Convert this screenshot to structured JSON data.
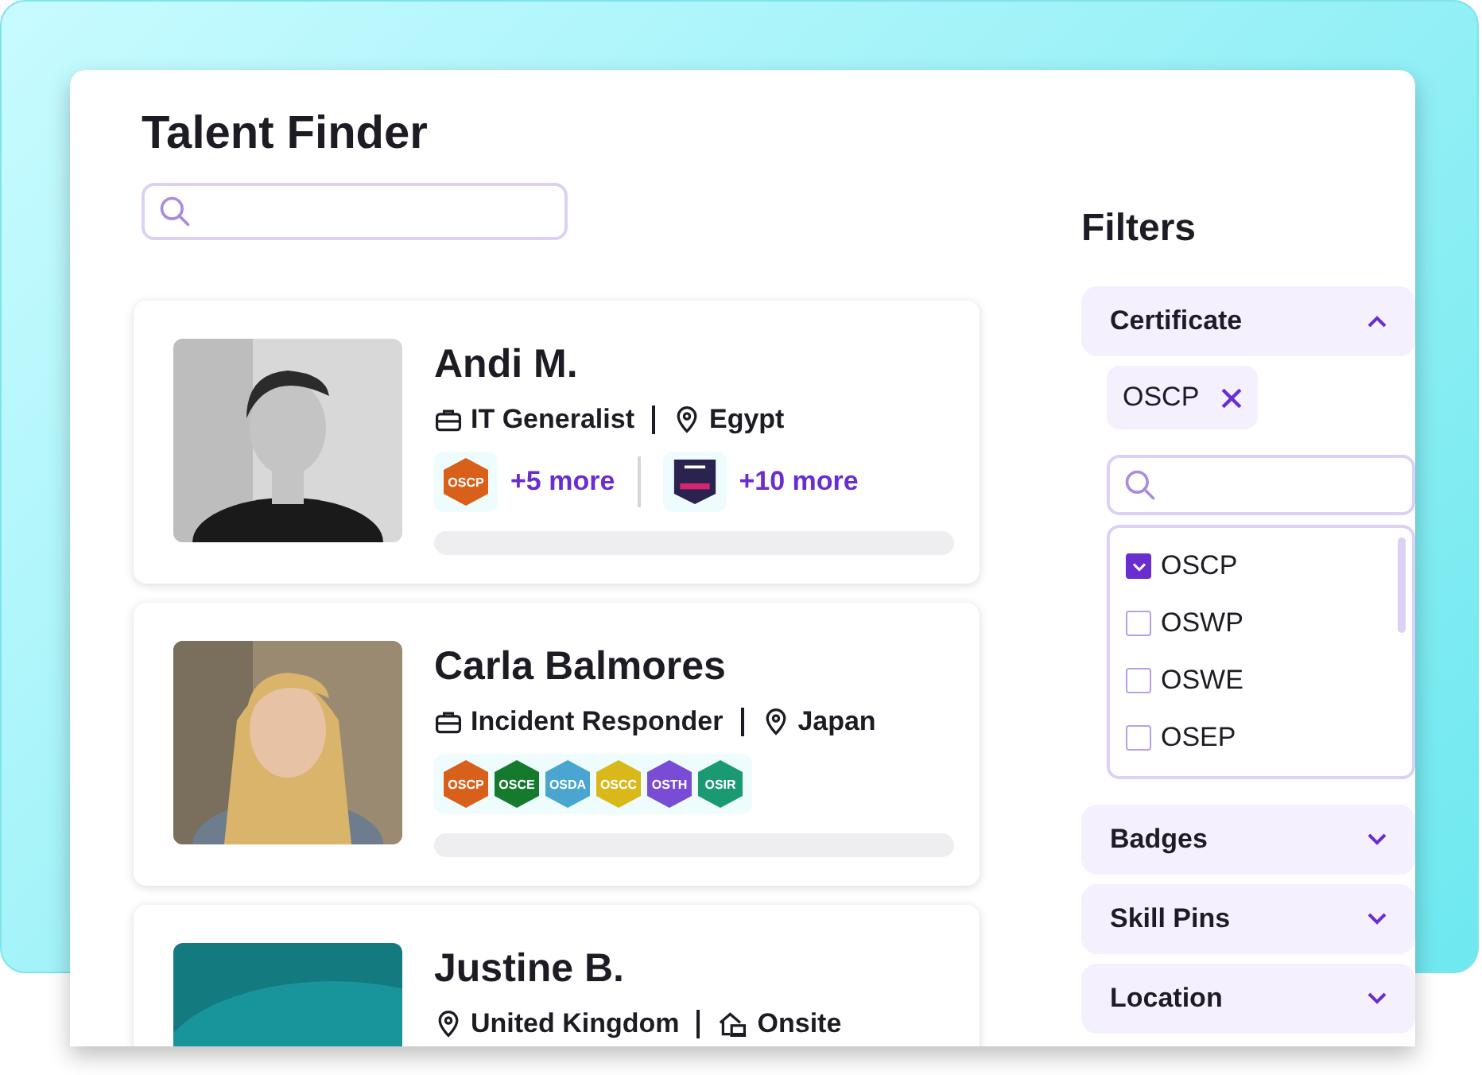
{
  "title": "Talent Finder",
  "candidates": [
    {
      "name": "Andi M.",
      "avatar": {
        "kind": "picture"
      },
      "meta": [
        {
          "kind": "role",
          "text": "IT Generalist"
        },
        {
          "kind": "location",
          "text": "Egypt"
        }
      ],
      "badge_groups": [
        {
          "badges": [
            {
              "kind": "hexagon",
              "label": "OSCP",
              "color": "#d9601a"
            }
          ],
          "more": "+5 more"
        },
        {
          "badges": [
            {
              "kind": "shield",
              "color": "#2a2350"
            }
          ],
          "more": "+10 more"
        }
      ]
    },
    {
      "name": "Carla Balmores",
      "avatar": {
        "kind": "picture"
      },
      "meta": [
        {
          "kind": "role",
          "text": "Incident Responder"
        },
        {
          "kind": "location",
          "text": "Japan"
        }
      ],
      "badge_groups": [
        {
          "badges": [
            {
              "kind": "hexagon",
              "label": "OSCP",
              "color": "#d9601a"
            },
            {
              "kind": "hexagon",
              "label": "OSCE",
              "color": "#167a2e"
            },
            {
              "kind": "hexagon",
              "label": "OSDA",
              "color": "#4aa6d0"
            },
            {
              "kind": "hexagon",
              "label": "OSCC",
              "color": "#d9b81a"
            },
            {
              "kind": "hexagon",
              "label": "OSTH",
              "color": "#7a4cd6"
            },
            {
              "kind": "hexagon",
              "label": "OSIR",
              "color": "#1a9a72"
            }
          ]
        }
      ]
    },
    {
      "name": "Justine B.",
      "avatar": {
        "kind": "initials-tile"
      },
      "meta": [
        {
          "kind": "location",
          "text": "United Kingdom"
        },
        {
          "kind": "workplace",
          "text": "Onsite"
        }
      ]
    }
  ],
  "filters": {
    "title": "Filters",
    "sections": [
      {
        "label": "Certificate",
        "expanded": true,
        "chips": [
          {
            "label": "OSCP"
          }
        ],
        "options": [
          {
            "label": "OSCP",
            "checked": true
          },
          {
            "label": "OSWP",
            "checked": false
          },
          {
            "label": "OSWE",
            "checked": false
          },
          {
            "label": "OSEP",
            "checked": false
          }
        ]
      },
      {
        "label": "Badges",
        "expanded": false
      },
      {
        "label": "Skill Pins",
        "expanded": false
      },
      {
        "label": "Location",
        "expanded": false
      }
    ]
  }
}
